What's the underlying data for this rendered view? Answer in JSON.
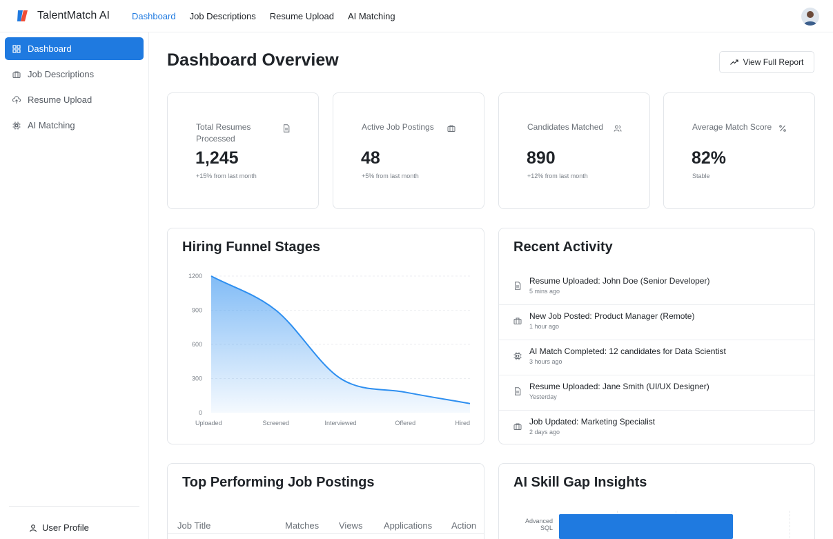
{
  "app": {
    "name": "TalentMatch AI"
  },
  "topnav": [
    {
      "label": "Dashboard",
      "active": true
    },
    {
      "label": "Job Descriptions",
      "active": false
    },
    {
      "label": "Resume Upload",
      "active": false
    },
    {
      "label": "AI Matching",
      "active": false
    }
  ],
  "sidebar": {
    "items": [
      {
        "label": "Dashboard",
        "icon": "grid-icon",
        "active": true
      },
      {
        "label": "Job Descriptions",
        "icon": "briefcase-icon",
        "active": false
      },
      {
        "label": "Resume Upload",
        "icon": "cloud-upload-icon",
        "active": false
      },
      {
        "label": "AI Matching",
        "icon": "cpu-icon",
        "active": false
      }
    ],
    "profile_label": "User Profile"
  },
  "page": {
    "title": "Dashboard Overview",
    "report_button": "View Full Report"
  },
  "stats": [
    {
      "label": "Total Resumes Processed",
      "value": "1,245",
      "sub": "+15% from last month",
      "icon": "file-icon"
    },
    {
      "label": "Active Job Postings",
      "value": "48",
      "sub": "+5% from last month",
      "icon": "briefcase-icon"
    },
    {
      "label": "Candidates Matched",
      "value": "890",
      "sub": "+12% from last month",
      "icon": "users-icon"
    },
    {
      "label": "Average Match Score",
      "value": "82%",
      "sub": "Stable",
      "icon": "percent-icon"
    }
  ],
  "funnel": {
    "title": "Hiring Funnel Stages"
  },
  "chart_data": {
    "type": "area",
    "title": "Hiring Funnel Stages",
    "categories": [
      "Uploaded",
      "Screened",
      "Interviewed",
      "Offered",
      "Hired"
    ],
    "values": [
      1200,
      900,
      300,
      180,
      80
    ],
    "y_ticks": [
      0,
      300,
      600,
      900,
      1200
    ],
    "ylim": [
      0,
      1200
    ],
    "grid": true,
    "color": "#2e8ff0"
  },
  "activity": {
    "title": "Recent Activity",
    "items": [
      {
        "text": "Resume Uploaded: John Doe (Senior Developer)",
        "time": "5 mins ago",
        "icon": "file-icon"
      },
      {
        "text": "New Job Posted: Product Manager (Remote)",
        "time": "1 hour ago",
        "icon": "briefcase-icon"
      },
      {
        "text": "AI Match Completed: 12 candidates for Data Scientist",
        "time": "3 hours ago",
        "icon": "cpu-icon"
      },
      {
        "text": "Resume Uploaded: Jane Smith (UI/UX Designer)",
        "time": "Yesterday",
        "icon": "file-icon"
      },
      {
        "text": "Job Updated: Marketing Specialist",
        "time": "2 days ago",
        "icon": "briefcase-icon"
      }
    ]
  },
  "top_postings": {
    "title": "Top Performing Job Postings",
    "columns": [
      "Job Title",
      "Matches",
      "Views",
      "Applications",
      "Action"
    ]
  },
  "skill_gap": {
    "title": "AI Skill Gap Insights",
    "skills": [
      {
        "name": "Advanced SQL",
        "value": 0.74
      }
    ]
  },
  "colors": {
    "accent": "#1f7ae0",
    "chart": "#2e8ff0"
  }
}
